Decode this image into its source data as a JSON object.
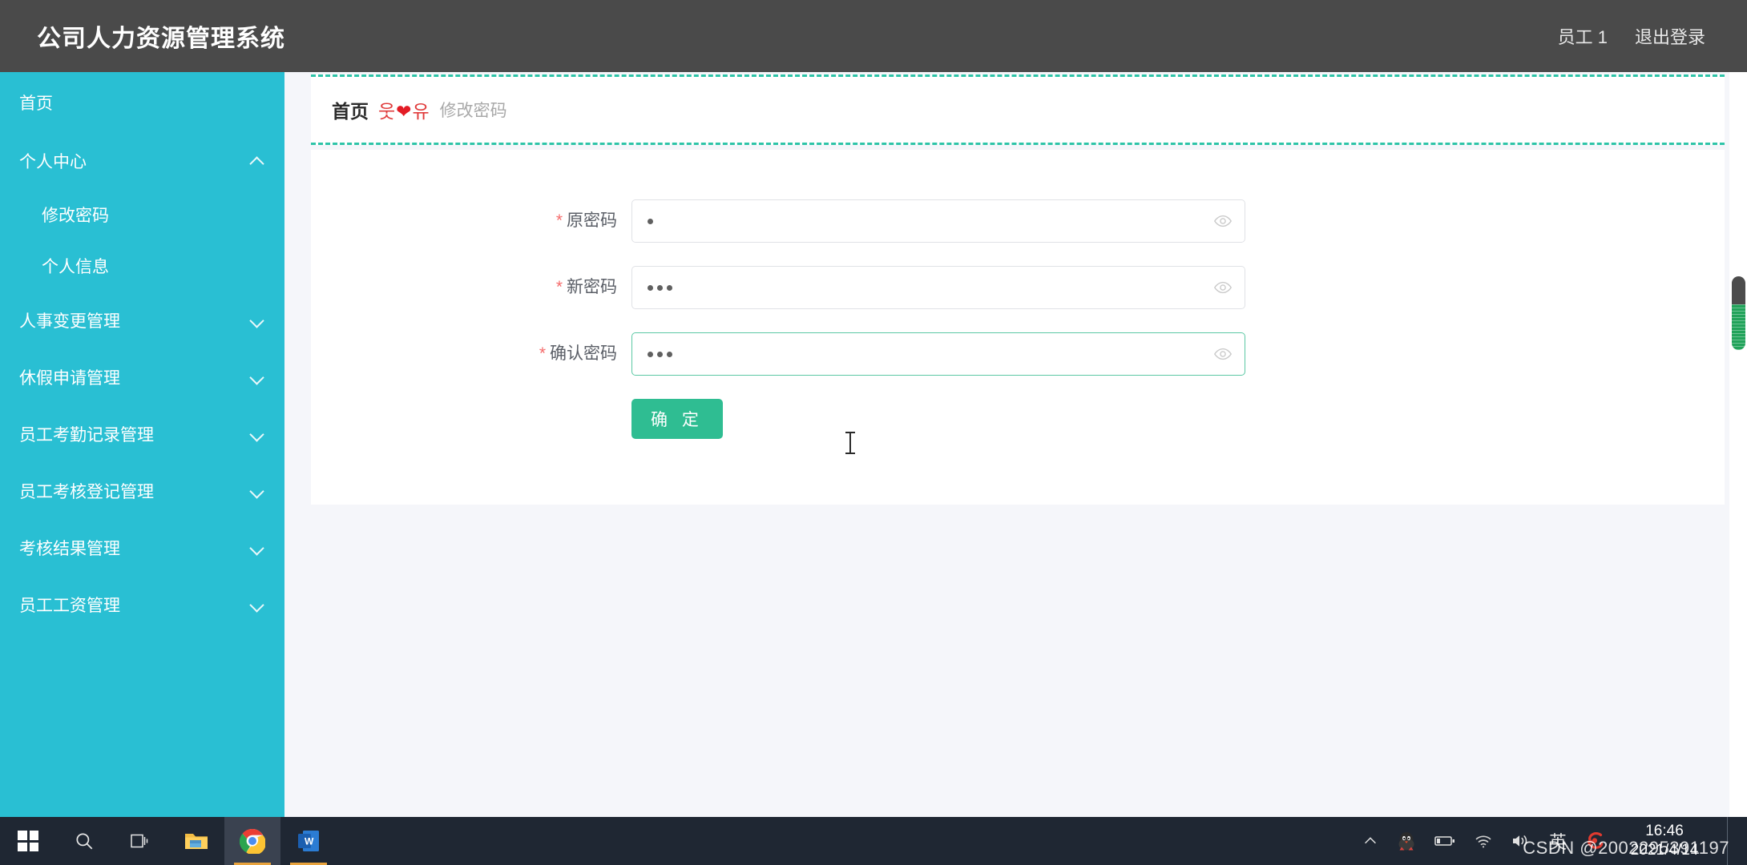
{
  "header": {
    "brand": "公司人力资源管理系统",
    "user": "员工 1",
    "logout": "退出登录"
  },
  "sidebar": {
    "items": [
      {
        "label": "首页",
        "type": "link",
        "icon": "none"
      },
      {
        "label": "个人中心",
        "type": "group",
        "icon": "chevron-up-icon"
      },
      {
        "label": "修改密码",
        "type": "sub"
      },
      {
        "label": "个人信息",
        "type": "sub"
      },
      {
        "label": "人事变更管理",
        "type": "group",
        "icon": "chevron-down-icon"
      },
      {
        "label": "休假申请管理",
        "type": "group",
        "icon": "chevron-down-icon"
      },
      {
        "label": "员工考勤记录管理",
        "type": "group",
        "icon": "chevron-down-icon"
      },
      {
        "label": "员工考核登记管理",
        "type": "group",
        "icon": "chevron-down-icon"
      },
      {
        "label": "考核结果管理",
        "type": "group",
        "icon": "chevron-down-icon"
      },
      {
        "label": "员工工资管理",
        "type": "group",
        "icon": "chevron-down-icon"
      }
    ]
  },
  "breadcrumb": {
    "home": "首页",
    "separator_left": "웃",
    "separator_heart": "❤",
    "separator_right": "유",
    "current": "修改密码"
  },
  "form": {
    "required_mark": "*",
    "fields": [
      {
        "label": "原密码",
        "value": "a",
        "masked_dots": 1,
        "placeholder": "",
        "focused": false,
        "eye_icon": "eye-icon"
      },
      {
        "label": "新密码",
        "value": "abc",
        "masked_dots": 3,
        "placeholder": "",
        "focused": false,
        "eye_icon": "eye-icon"
      },
      {
        "label": "确认密码",
        "value": "abc",
        "masked_dots": 3,
        "placeholder": "",
        "focused": true,
        "eye_icon": "eye-icon"
      }
    ],
    "submit_label": "确 定"
  },
  "colors": {
    "header_bg": "#4a4a4a",
    "sidebar_bg": "#29bfd3",
    "accent_green": "#2fbd92",
    "dashed_border": "#2ec4a8",
    "page_bg": "#f5f6fa",
    "required_star": "#f56c6c",
    "heart_red": "#e31c25",
    "taskbar_bg": "#1f2733"
  },
  "taskbar": {
    "buttons": [
      {
        "name": "start-button",
        "icon": "windows-logo-icon"
      },
      {
        "name": "search-button",
        "icon": "search-icon"
      },
      {
        "name": "task-view-button",
        "icon": "task-view-icon"
      },
      {
        "name": "file-explorer-button",
        "icon": "folder-icon"
      },
      {
        "name": "chrome-button",
        "icon": "chrome-icon"
      },
      {
        "name": "word-button",
        "icon": "word-icon"
      }
    ],
    "tray": [
      {
        "name": "show-hidden-icons",
        "icon": "chevron-up-icon"
      },
      {
        "name": "qq-tray-icon",
        "icon": "penguin-icon"
      },
      {
        "name": "battery-tray-icon",
        "icon": "battery-icon"
      },
      {
        "name": "network-tray-icon",
        "icon": "wifi-icon"
      },
      {
        "name": "volume-tray-icon",
        "icon": "speaker-icon"
      },
      {
        "name": "ime-indicator",
        "icon": "ime-chinese-icon",
        "label": "英"
      },
      {
        "name": "sogou-tray-icon",
        "icon": "sogou-icon"
      }
    ],
    "clock_time": "16:46",
    "clock_date": "2021/4/14"
  },
  "watermark": "CSDN @2002295391197"
}
